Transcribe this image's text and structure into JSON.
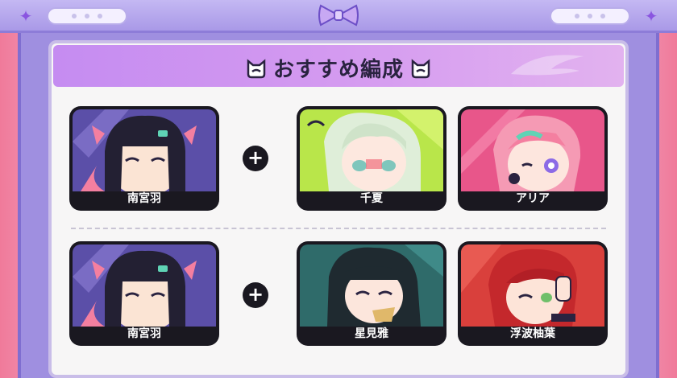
{
  "panel": {
    "title": "おすすめ編成"
  },
  "colors": {
    "header_accent": "#c58cf1",
    "frame": "#9f8fe0",
    "card_bg": "#1a1820"
  },
  "formations": [
    {
      "leader": {
        "name": "南宮羽",
        "portrait_bg": "#5b4fa8"
      },
      "partners": [
        {
          "name": "千夏",
          "portrait_bg": "#b9e64a"
        },
        {
          "name": "アリア",
          "portrait_bg": "#e8568a"
        }
      ]
    },
    {
      "leader": {
        "name": "南宮羽",
        "portrait_bg": "#5b4fa8"
      },
      "partners": [
        {
          "name": "星見雅",
          "portrait_bg": "#2f6b6a"
        },
        {
          "name": "浮波柚葉",
          "portrait_bg": "#d9403c"
        }
      ]
    }
  ],
  "icons": {
    "plus": "+",
    "corner_left": "sparkle-icon",
    "corner_right": "sparkle-icon",
    "top_center": "bow-icon",
    "title_badge": "cat-face-icon"
  }
}
